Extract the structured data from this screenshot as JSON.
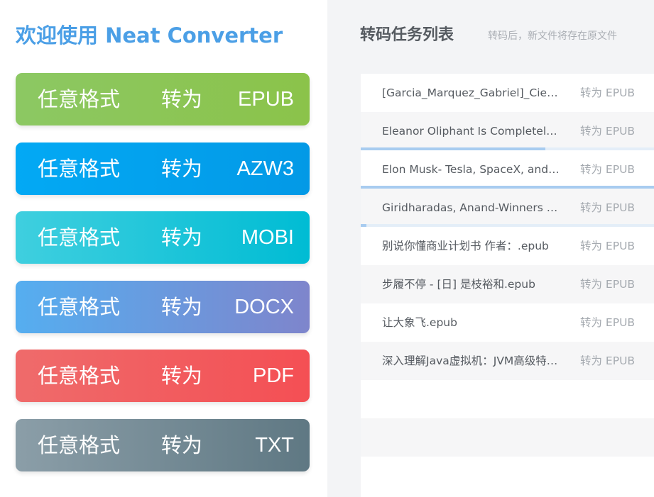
{
  "app": {
    "title": "欢迎使用 Neat Converter"
  },
  "converters": [
    {
      "any": "任意格式",
      "to": "转为",
      "format": "EPUB",
      "color_from": "#8cc863",
      "color_to": "#8bc34a"
    },
    {
      "any": "任意格式",
      "to": "转为",
      "format": "AZW3",
      "color_from": "#03a9f4",
      "color_to": "#0399e6"
    },
    {
      "any": "任意格式",
      "to": "转为",
      "format": "MOBI",
      "color_from": "#3fcfdf",
      "color_to": "#00bcd4"
    },
    {
      "any": "任意格式",
      "to": "转为",
      "format": "DOCX",
      "color_from": "#55aef0",
      "color_to": "#7e85cc"
    },
    {
      "any": "任意格式",
      "to": "转为",
      "format": "PDF",
      "color_from": "#ef6b6b",
      "color_to": "#f44f54"
    },
    {
      "any": "任意格式",
      "to": "转为",
      "format": "TXT",
      "color_from": "#8b9ea8",
      "color_to": "#5f7883"
    }
  ],
  "task_list": {
    "title": "转码任务列表",
    "hint": "转码后，新文件将存在原文件",
    "rows": [
      {
        "name": "[Garcia_Marquez_Gabriel]_Cien_años_de_soledad.epub",
        "status": "转为 EPUB",
        "progress": null
      },
      {
        "name": "Eleanor Oliphant Is Completely Fine.epub",
        "status": "转为 EPUB",
        "progress": 0.63
      },
      {
        "name": "Elon Musk- Tesla, SpaceX, and the Quest.epub",
        "status": "转为 EPUB",
        "progress": 1.0
      },
      {
        "name": "Giridharadas, Anand-Winners Take All.epub",
        "status": "转为 EPUB",
        "progress": 0.02
      },
      {
        "name": "别说你懂商业计划书 作者：.epub",
        "status": "转为 EPUB",
        "progress": null
      },
      {
        "name": "步履不停 - [日] 是枝裕和.epub",
        "status": "转为 EPUB",
        "progress": null
      },
      {
        "name": "让大象飞.epub",
        "status": "转为 EPUB",
        "progress": null
      },
      {
        "name": "深入理解Java虚拟机：JVM高级特性与最佳实践.epub",
        "status": "转为 EPUB",
        "progress": null
      }
    ]
  }
}
